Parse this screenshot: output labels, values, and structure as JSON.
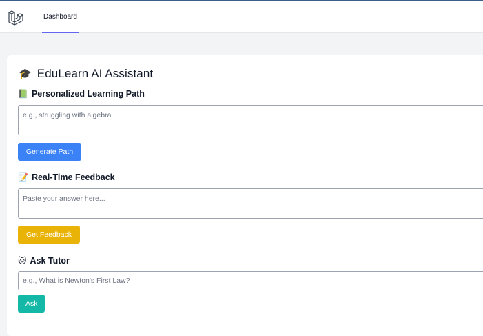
{
  "nav": {
    "logo_icon": "laravel-logo-icon",
    "dashboard_label": "Dashboard"
  },
  "main": {
    "title_emoji": "🎓",
    "title": "EduLearn AI Assistant",
    "sections": {
      "learning_path": {
        "emoji": "📗",
        "title": "Personalized Learning Path",
        "placeholder": "e.g., struggling with algebra",
        "value": "",
        "button_label": "Generate Path"
      },
      "feedback": {
        "emoji": "📝",
        "title": "Real-Time Feedback",
        "placeholder": "Paste your answer here...",
        "value": "",
        "button_label": "Get Feedback"
      },
      "tutor": {
        "emoji": "🐱",
        "title": "Ask Tutor",
        "placeholder": "e.g., What is Newton's First Law?",
        "value": "",
        "button_label": "Ask"
      }
    }
  },
  "colors": {
    "blue_button": "#3b82f6",
    "yellow_button": "#eab308",
    "teal_button": "#14b8a6",
    "nav_underline": "#6366f1"
  }
}
